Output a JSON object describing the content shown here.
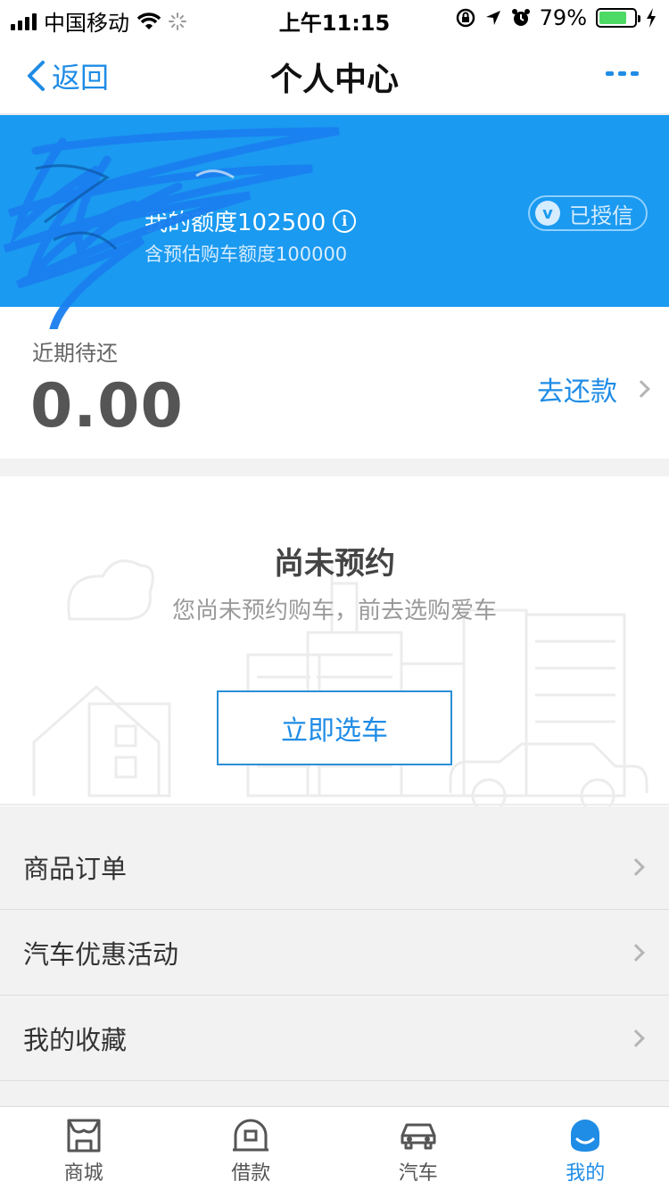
{
  "status_bar": {
    "carrier": "中国移动",
    "time": "上午11:15",
    "battery": "79%",
    "battery_level": 0.79
  },
  "nav": {
    "back_label": "返回",
    "title": "个人中心"
  },
  "banner": {
    "quota_label": "我的额度102500",
    "sub_quota": "含预估购车额度100000",
    "auth_badge": "已授信",
    "auth_icon_letter": "v",
    "info_icon": "i",
    "color": "#1a9af0"
  },
  "repayment": {
    "label": "近期待还",
    "amount": "0.00",
    "action": "去还款"
  },
  "reservation": {
    "title": "尚未预约",
    "subtitle": "您尚未预约购车，前去选购爱车",
    "button": "立即选车"
  },
  "menu": {
    "items": [
      {
        "label": "商品订单"
      },
      {
        "label": "汽车优惠活动"
      },
      {
        "label": "我的收藏"
      }
    ]
  },
  "tabbar": {
    "accent": "#1f8ce6",
    "tabs": [
      {
        "label": "商城",
        "icon": "store-icon"
      },
      {
        "label": "借款",
        "icon": "loan-icon"
      },
      {
        "label": "汽车",
        "icon": "car-icon"
      },
      {
        "label": "我的",
        "icon": "profile-icon"
      }
    ]
  }
}
